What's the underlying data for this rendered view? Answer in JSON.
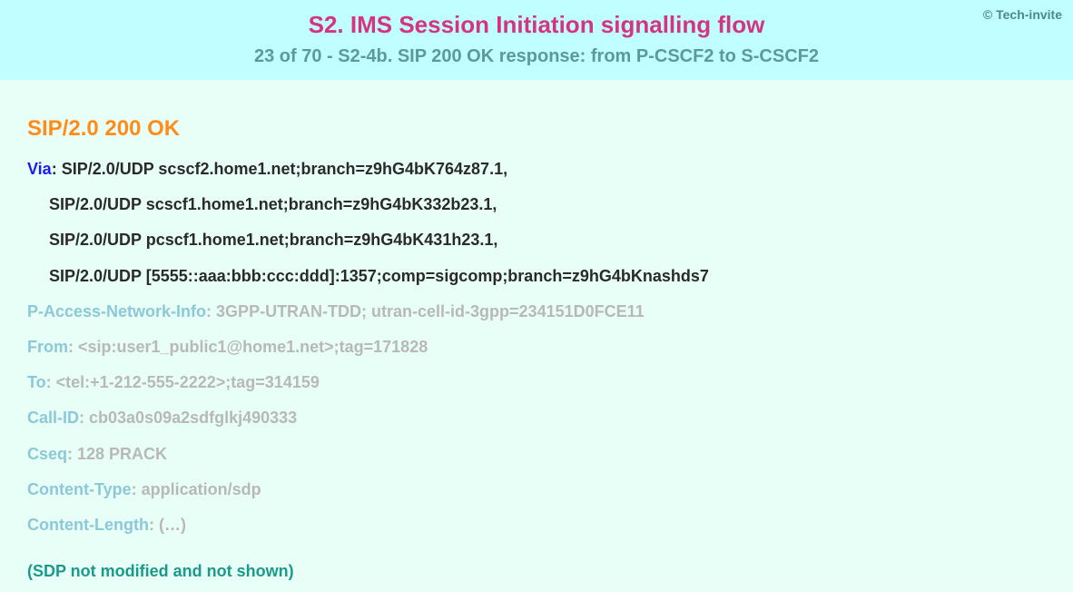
{
  "copyright": "© Tech-invite",
  "title": "S2. IMS Session Initiation signalling flow",
  "subtitle": "23 of 70 - S2-4b. SIP 200 OK response: from P-CSCF2 to S-CSCF2",
  "statusLine": "SIP/2.0 200 OK",
  "via": {
    "name": "Via",
    "lines": [
      "SIP/2.0/UDP scscf2.home1.net;branch=z9hG4bK764z87.1,",
      "SIP/2.0/UDP scscf1.home1.net;branch=z9hG4bK332b23.1,",
      "SIP/2.0/UDP pcscf1.home1.net;branch=z9hG4bK431h23.1,",
      "SIP/2.0/UDP [5555::aaa:bbb:ccc:ddd]:1357;comp=sigcomp;branch=z9hG4bKnashds7"
    ]
  },
  "secondaryHeaders": [
    {
      "name": "P-Access-Network-Info",
      "value": "3GPP-UTRAN-TDD; utran-cell-id-3gpp=234151D0FCE11"
    },
    {
      "name": "From",
      "value": "<sip:user1_public1@home1.net>;tag=171828"
    },
    {
      "name": "To",
      "value": "<tel:+1-212-555-2222>;tag=314159"
    },
    {
      "name": "Call-ID",
      "value": "cb03a0s09a2sdfglkj490333"
    },
    {
      "name": "Cseq",
      "value": "128 PRACK"
    },
    {
      "name": "Content-Type",
      "value": "application/sdp"
    },
    {
      "name": "Content-Length",
      "value": "(…)"
    }
  ],
  "sdpNote": "(SDP not modified and not shown)"
}
